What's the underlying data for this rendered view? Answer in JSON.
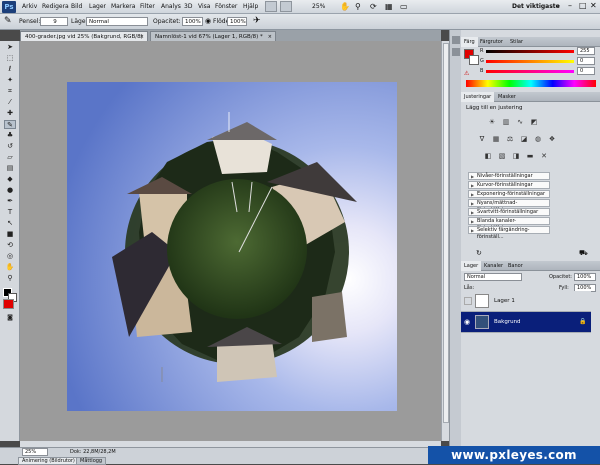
{
  "menubar": {
    "items": [
      "Arkiv",
      "Redigera",
      "Bild",
      "Lager",
      "Markera",
      "Filter",
      "Analys",
      "3D",
      "Visa",
      "Fönster",
      "Hjälp"
    ],
    "zoom": "25%",
    "workspace": "Det viktigaste"
  },
  "options": {
    "brush_label": "Pensel:",
    "brush_size": "9",
    "mode_label": "Läge:",
    "mode_value": "Normal",
    "opacity_label": "Opacitet:",
    "opacity_value": "100%",
    "flow_label": "Flöde:",
    "flow_value": "100%"
  },
  "doc_tabs": [
    "400-grader.jpg vid 25% (Bakgrund, RGB/8) *",
    "Namnlöst-1 vid 67% (Lager 1, RGB/8) *"
  ],
  "status": {
    "zoom": "25%",
    "doc_size": "Dok: 22,8M/28,2M",
    "bottom_tabs": [
      "Animering (Bildrutor)",
      "Måttlogg"
    ]
  },
  "color_panel": {
    "tabs": [
      "Färg",
      "Färgrutor",
      "Stilar"
    ],
    "r_value": "255",
    "g_value": "0",
    "b_value": "0",
    "fg_color": "#e00000"
  },
  "adjustments": {
    "tabs": [
      "Justeringar",
      "Masker"
    ],
    "title": "Lägg till en justering",
    "presets": [
      "Nivåer-förinställningar",
      "Kurvor-förinställningar",
      "Exponering-förinställningar",
      "Nyans/mättnad-förinställningar",
      "Svartvitt-förinställningar",
      "Blanda kanaler-förinställningar",
      "Selektiv färgändring-förinställ..."
    ]
  },
  "layers": {
    "tabs": [
      "Lager",
      "Kanaler",
      "Banor"
    ],
    "blend_mode": "Normal",
    "opacity_label": "Opacitet:",
    "opacity_value": "100%",
    "fill_label": "Fyll:",
    "fill_value": "100%",
    "lock_label": "Lås:",
    "rows": [
      {
        "name": "Lager 1",
        "selected": false
      },
      {
        "name": "Bakgrund",
        "selected": true
      }
    ]
  },
  "watermark": "www.pxleyes.com"
}
